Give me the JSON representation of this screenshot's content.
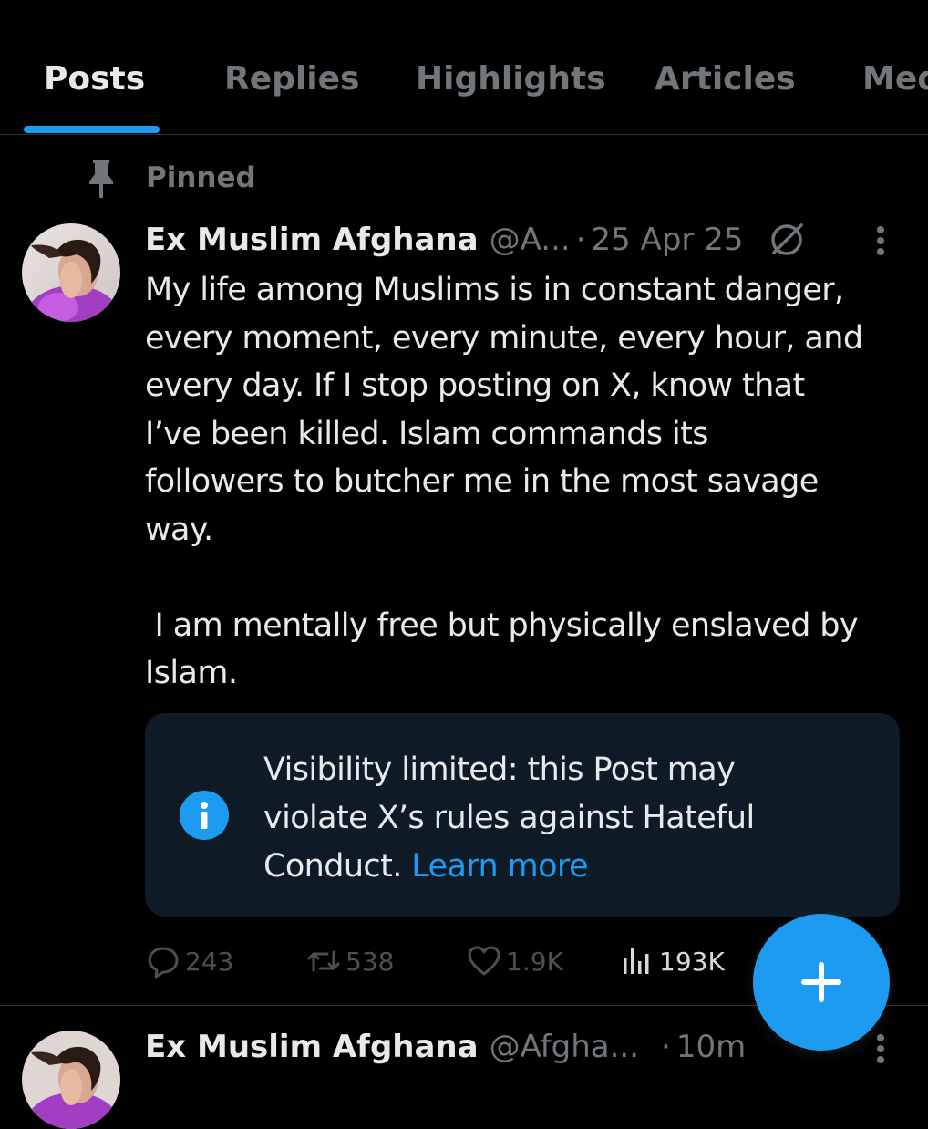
{
  "tabs": [
    {
      "label": "Posts",
      "active": true
    },
    {
      "label": "Replies",
      "active": false
    },
    {
      "label": "Highlights",
      "active": false
    },
    {
      "label": "Articles",
      "active": false
    },
    {
      "label": "Media",
      "active": false
    }
  ],
  "pinned": {
    "label": "Pinned",
    "icon": "pin-icon"
  },
  "post": {
    "author_name": "Ex Muslim Afghana",
    "handle": "@A...",
    "separator": "·",
    "time": "25 Apr 25",
    "text": "My life among Muslims is in constant danger,\nevery moment, every minute, every hour, and\nevery day. If I stop posting on X, know that\nI’ve been killed. Islam commands its\nfollowers to butcher me in the most savage\nway.\n\n I am mentally free but physically enslaved by\nIslam.",
    "notice": {
      "text": "Visibility limited: this Post may violate X’s rules against Hateful Conduct.",
      "link": "Learn more",
      "icon": "info-icon"
    },
    "stats": {
      "replies": "243",
      "reposts": "538",
      "likes": "1.9K",
      "views": "193K"
    }
  },
  "next_post": {
    "author_name": "Ex Muslim Afghana",
    "handle": "@Afgha...",
    "separator": "·",
    "time": "10m"
  },
  "colors": {
    "background": "#000000",
    "accent": "#1d9bf0",
    "text_primary": "#e7e9ea",
    "text_secondary": "#71767b",
    "notice_background": "#0e1a25",
    "divider": "#2f3336"
  }
}
